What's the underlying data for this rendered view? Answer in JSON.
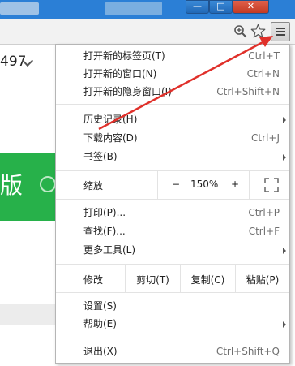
{
  "menu": {
    "items_top": [
      {
        "label": "打开新的标签页(T)",
        "shortcut": "Ctrl+T"
      },
      {
        "label": "打开新的窗口(N)",
        "shortcut": "Ctrl+N"
      },
      {
        "label": "打开新的隐身窗口(I)",
        "shortcut": "Ctrl+Shift+N"
      }
    ],
    "items_history": [
      {
        "label": "历史记录(H)",
        "shortcut": ""
      },
      {
        "label": "下载内容(D)",
        "shortcut": "Ctrl+J"
      },
      {
        "label": "书签(B)",
        "shortcut": ""
      }
    ],
    "zoom": {
      "label": "缩放",
      "minus": "−",
      "value": "150%",
      "plus": "+"
    },
    "items_tools": [
      {
        "label": "打印(P)...",
        "shortcut": "Ctrl+P"
      },
      {
        "label": "查找(F)...",
        "shortcut": "Ctrl+F"
      },
      {
        "label": "更多工具(L)",
        "shortcut": ""
      }
    ],
    "edit": {
      "label": "修改",
      "cut": "剪切(T)",
      "copy": "复制(C)",
      "paste": "粘贴(P)"
    },
    "items_settings": [
      {
        "label": "设置(S)",
        "shortcut": ""
      },
      {
        "label": "帮助(E)",
        "shortcut": ""
      }
    ],
    "exit": {
      "label": "退出(X)",
      "shortcut": "Ctrl+Shift+Q"
    }
  },
  "background": {
    "page_number": "497",
    "green_char": "版"
  },
  "window_controls": {
    "minimize": "—",
    "maximize": "□",
    "close": "✕"
  },
  "colors": {
    "titlebar": "#2b7fd6",
    "annotation_arrow": "#e0302a",
    "green_banner": "#27b14a"
  },
  "icons": [
    "zoom-icon",
    "bookmark-star-icon",
    "menu-icon",
    "fullscreen-icon",
    "submenu-arrow-icon"
  ]
}
